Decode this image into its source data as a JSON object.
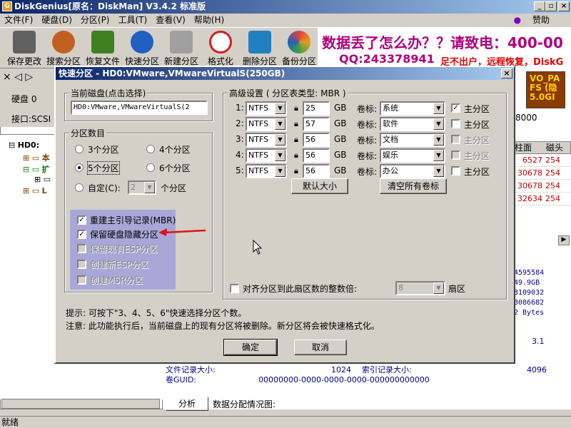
{
  "window": {
    "title": "DiskGenius[原名：DiskMan] V3.4.2 标准版"
  },
  "menu": {
    "items": [
      "文件(F)",
      "硬盘(D)",
      "分区(P)",
      "工具(T)",
      "查看(V)",
      "帮助(H)"
    ],
    "sponsor": "赞助"
  },
  "toolbar": {
    "items": [
      {
        "label": "保存更改",
        "icon": "save-icon",
        "color": "#606060"
      },
      {
        "label": "搜索分区",
        "icon": "search-icon",
        "color": "#c06020"
      },
      {
        "label": "恢复文件",
        "icon": "recover-icon",
        "color": "#408020"
      },
      {
        "label": "快速分区",
        "icon": "quick-partition-icon",
        "color": "#2060c0"
      },
      {
        "label": "新建分区",
        "icon": "new-partition-icon",
        "color": "#808080"
      },
      {
        "label": "格式化",
        "icon": "format-icon",
        "color": "#d02020"
      },
      {
        "label": "删除分区",
        "icon": "delete-icon",
        "color": "#2080c0"
      },
      {
        "label": "备份分区",
        "icon": "backup-icon",
        "color": "#e0a020"
      }
    ]
  },
  "ad": {
    "line1": "数据丢了怎么办？？请致电：400-00",
    "line2": "QQ:243378941",
    "line3": "足不出户，远程恢复，DiskG"
  },
  "left": {
    "disk_label": "硬盘 0",
    "interface_label": "接口:SCSI",
    "tree": [
      "HD0:",
      "本",
      "扩",
      "L"
    ]
  },
  "right": {
    "speed": "8000",
    "cube": [
      "VO_PA",
      "FS (隐",
      "5.0GI"
    ],
    "col_headers": [
      "柱面",
      "磁头"
    ],
    "rows": [
      [
        "6527",
        "254"
      ],
      [
        "30678",
        "254"
      ],
      [
        "30678",
        "254"
      ],
      [
        "32634",
        "254"
      ]
    ],
    "nums": [
      "4595584",
      "49.9GB",
      "3109032",
      "3086682",
      "2 Bytes"
    ],
    "ver": "3.1",
    "file_record_label": "文件记录大小:",
    "file_record_val": "1024",
    "index_record_label": "索引记录大小:",
    "index_record_val": "4096",
    "guid_label": "卷GUID:",
    "guid_val": "00000000-0000-0000-0000-000000000000",
    "analyze": "分析",
    "alloc_label": "数据分配情况图:"
  },
  "status": "就绪",
  "dialog": {
    "title": "快速分区 - HD0:VMware,VMwareVirtualS(250GB)",
    "current_disk_label": "当前磁盘(点击选择)",
    "current_disk": "HD0:VMware,VMwareVirtualS(2",
    "count_label": "分区数目",
    "radios": [
      "3个分区",
      "4个分区",
      "5个分区",
      "6个分区"
    ],
    "selected_radio": "5个分区",
    "custom_label": "自定(C):",
    "custom_value": "2",
    "custom_suffix": "个分区",
    "options": [
      {
        "label": "重建主引导记录(MBR)",
        "checked": true,
        "enabled": true
      },
      {
        "label": "保留硬盘隐藏分区",
        "checked": true,
        "enabled": true
      },
      {
        "label": "保留现有ESP分区",
        "checked": false,
        "enabled": false
      },
      {
        "label": "创建新ESP分区",
        "checked": false,
        "enabled": false
      },
      {
        "label": "创建MSR分区",
        "checked": false,
        "enabled": false
      }
    ],
    "adv_label": "高级设置 ( 分区表类型: MBR )",
    "partitions": [
      {
        "idx": "1:",
        "fs": "NTFS",
        "size": "25",
        "unit": "GB",
        "vol_label": "卷标:",
        "name": "系统",
        "primary": true,
        "primary_enabled": true
      },
      {
        "idx": "2:",
        "fs": "NTFS",
        "size": "57",
        "unit": "GB",
        "vol_label": "卷标:",
        "name": "软件",
        "primary": false,
        "primary_enabled": true
      },
      {
        "idx": "3:",
        "fs": "NTFS",
        "size": "56",
        "unit": "GB",
        "vol_label": "卷标:",
        "name": "文档",
        "primary": false,
        "primary_enabled": false
      },
      {
        "idx": "4:",
        "fs": "NTFS",
        "size": "56",
        "unit": "GB",
        "vol_label": "卷标:",
        "name": "娱乐",
        "primary": false,
        "primary_enabled": false
      },
      {
        "idx": "5:",
        "fs": "NTFS",
        "size": "56",
        "unit": "GB",
        "vol_label": "卷标:",
        "name": "办公",
        "primary": false,
        "primary_enabled": true
      }
    ],
    "primary_label": "主分区",
    "default_size_btn": "默认大小",
    "clear_labels_btn": "清空所有卷标",
    "align_label": "对齐分区到此扇区数的整数倍:",
    "align_value": "8",
    "align_unit": "扇区",
    "tip": "提示: 可按下\"3、4、5、6\"快速选择分区个数。",
    "note": "注意: 此功能执行后，当前磁盘上的现有分区将被删除。新分区将会被快速格式化。",
    "ok": "确定",
    "cancel": "取消"
  }
}
